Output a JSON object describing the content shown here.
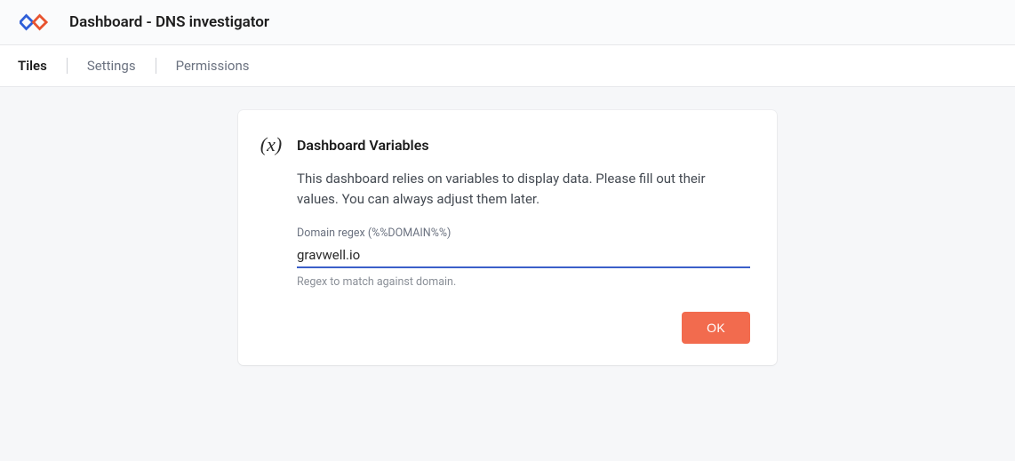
{
  "header": {
    "title": "Dashboard - DNS investigator"
  },
  "tabs": {
    "items": [
      {
        "label": "Tiles",
        "active": true
      },
      {
        "label": "Settings",
        "active": false
      },
      {
        "label": "Permissions",
        "active": false
      }
    ]
  },
  "dialog": {
    "icon_symbol": "(x)",
    "title": "Dashboard Variables",
    "description": "This dashboard relies on variables to display data. Please fill out their values. You can always adjust them later.",
    "field": {
      "label": "Domain regex (%%DOMAIN%%)",
      "value": "gravwell.io",
      "help": "Regex to match against domain."
    },
    "ok_label": "OK"
  }
}
